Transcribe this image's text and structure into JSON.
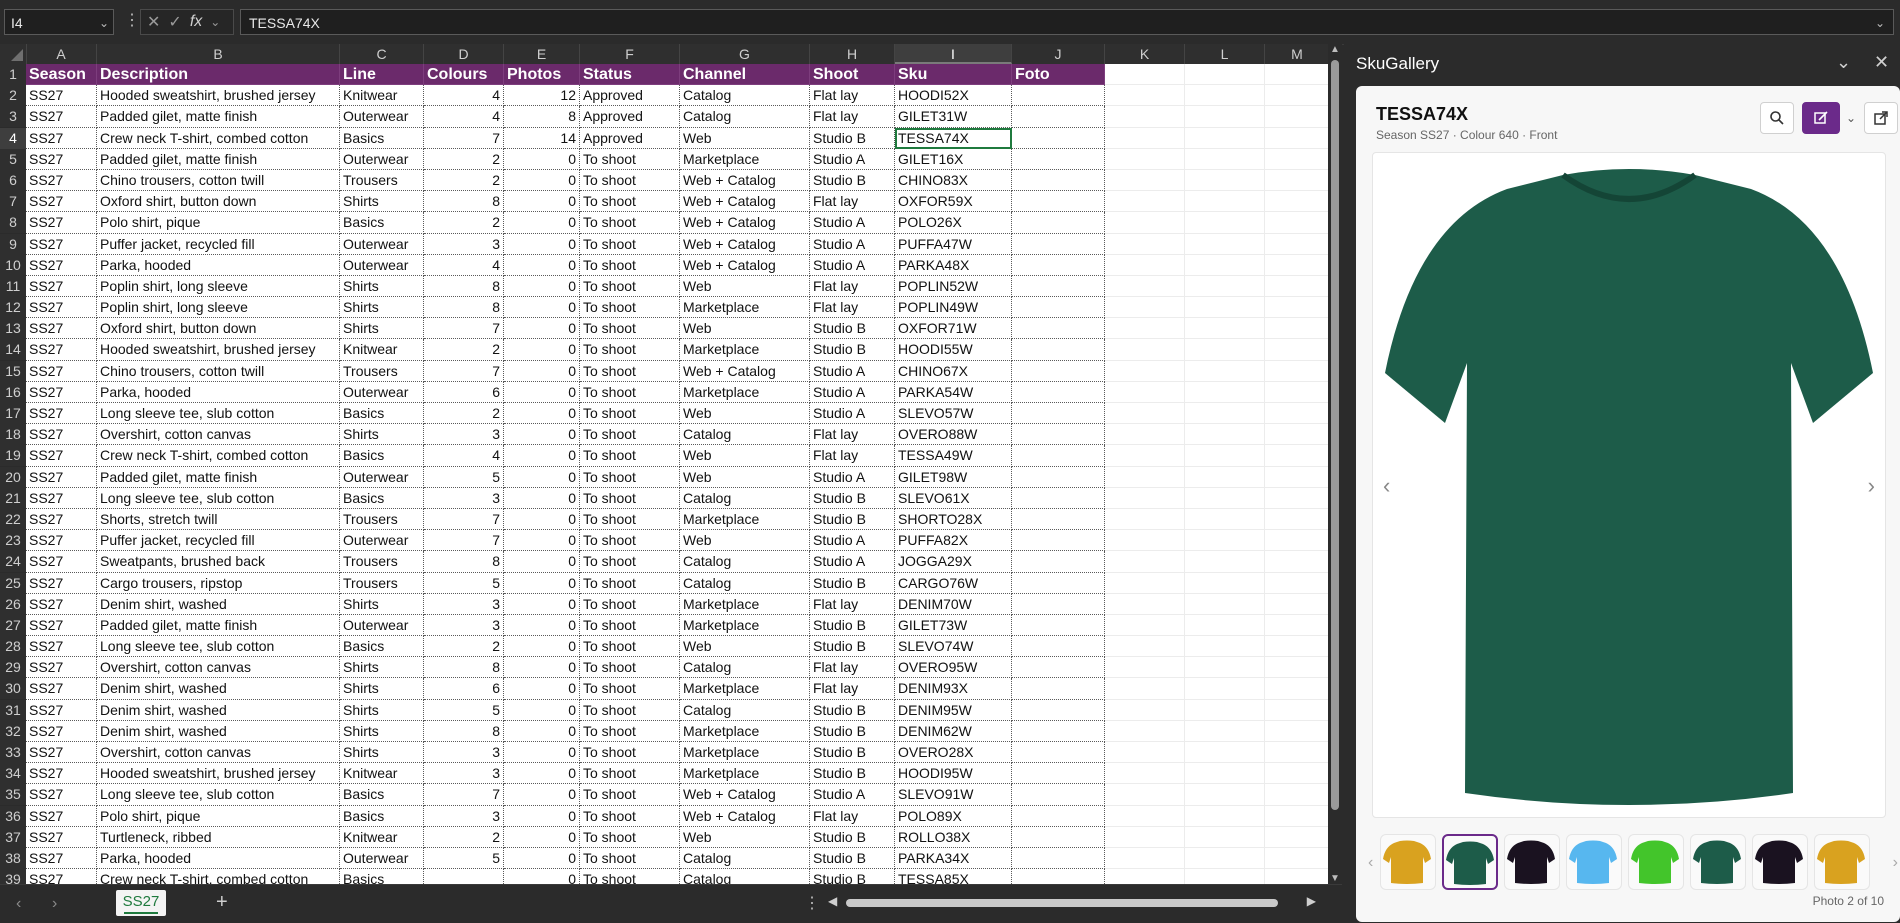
{
  "formula_bar": {
    "name_box": "I4",
    "value": "TESSA74X"
  },
  "columns": [
    "A",
    "B",
    "C",
    "D",
    "E",
    "F",
    "G",
    "H",
    "I",
    "J",
    "K",
    "L",
    "M"
  ],
  "selected_column": "I",
  "selected_row": 4,
  "headers": [
    "Season",
    "Description",
    "Line",
    "Colours",
    "Photos",
    "Status",
    "Channel",
    "Shoot",
    "Sku",
    "Foto"
  ],
  "rows": [
    [
      "SS27",
      "Hooded sweatshirt, brushed jersey",
      "Knitwear",
      "4",
      "12",
      "Approved",
      "Catalog",
      "Flat lay",
      "HOODI52X"
    ],
    [
      "SS27",
      "Padded gilet, matte finish",
      "Outerwear",
      "4",
      "8",
      "Approved",
      "Catalog",
      "Flat lay",
      "GILET31W"
    ],
    [
      "SS27",
      "Crew neck T-shirt, combed cotton",
      "Basics",
      "7",
      "14",
      "Approved",
      "Web",
      "Studio B",
      "TESSA74X"
    ],
    [
      "SS27",
      "Padded gilet, matte finish",
      "Outerwear",
      "2",
      "0",
      "To shoot",
      "Marketplace",
      "Studio A",
      "GILET16X"
    ],
    [
      "SS27",
      "Chino trousers, cotton twill",
      "Trousers",
      "2",
      "0",
      "To shoot",
      "Web + Catalog",
      "Studio B",
      "CHINO83X"
    ],
    [
      "SS27",
      "Oxford shirt, button down",
      "Shirts",
      "8",
      "0",
      "To shoot",
      "Web + Catalog",
      "Flat lay",
      "OXFOR59X"
    ],
    [
      "SS27",
      "Polo shirt, pique",
      "Basics",
      "2",
      "0",
      "To shoot",
      "Web + Catalog",
      "Studio A",
      "POLO26X"
    ],
    [
      "SS27",
      "Puffer jacket, recycled fill",
      "Outerwear",
      "3",
      "0",
      "To shoot",
      "Web + Catalog",
      "Studio A",
      "PUFFA47W"
    ],
    [
      "SS27",
      "Parka, hooded",
      "Outerwear",
      "4",
      "0",
      "To shoot",
      "Web + Catalog",
      "Studio A",
      "PARKA48X"
    ],
    [
      "SS27",
      "Poplin shirt, long sleeve",
      "Shirts",
      "8",
      "0",
      "To shoot",
      "Web",
      "Flat lay",
      "POPLIN52W"
    ],
    [
      "SS27",
      "Poplin shirt, long sleeve",
      "Shirts",
      "8",
      "0",
      "To shoot",
      "Marketplace",
      "Flat lay",
      "POPLIN49W"
    ],
    [
      "SS27",
      "Oxford shirt, button down",
      "Shirts",
      "7",
      "0",
      "To shoot",
      "Web",
      "Studio B",
      "OXFOR71W"
    ],
    [
      "SS27",
      "Hooded sweatshirt, brushed jersey",
      "Knitwear",
      "2",
      "0",
      "To shoot",
      "Marketplace",
      "Studio B",
      "HOODI55W"
    ],
    [
      "SS27",
      "Chino trousers, cotton twill",
      "Trousers",
      "7",
      "0",
      "To shoot",
      "Web + Catalog",
      "Studio A",
      "CHINO67X"
    ],
    [
      "SS27",
      "Parka, hooded",
      "Outerwear",
      "6",
      "0",
      "To shoot",
      "Marketplace",
      "Studio A",
      "PARKA54W"
    ],
    [
      "SS27",
      "Long sleeve tee, slub cotton",
      "Basics",
      "2",
      "0",
      "To shoot",
      "Web",
      "Studio A",
      "SLEVO57W"
    ],
    [
      "SS27",
      "Overshirt, cotton canvas",
      "Shirts",
      "3",
      "0",
      "To shoot",
      "Catalog",
      "Flat lay",
      "OVERO88W"
    ],
    [
      "SS27",
      "Crew neck T-shirt, combed cotton",
      "Basics",
      "4",
      "0",
      "To shoot",
      "Web",
      "Flat lay",
      "TESSA49W"
    ],
    [
      "SS27",
      "Padded gilet, matte finish",
      "Outerwear",
      "5",
      "0",
      "To shoot",
      "Web",
      "Studio A",
      "GILET98W"
    ],
    [
      "SS27",
      "Long sleeve tee, slub cotton",
      "Basics",
      "3",
      "0",
      "To shoot",
      "Catalog",
      "Studio B",
      "SLEVO61X"
    ],
    [
      "SS27",
      "Shorts, stretch twill",
      "Trousers",
      "7",
      "0",
      "To shoot",
      "Marketplace",
      "Studio B",
      "SHORTO28X"
    ],
    [
      "SS27",
      "Puffer jacket, recycled fill",
      "Outerwear",
      "7",
      "0",
      "To shoot",
      "Web",
      "Studio A",
      "PUFFA82X"
    ],
    [
      "SS27",
      "Sweatpants, brushed back",
      "Trousers",
      "8",
      "0",
      "To shoot",
      "Catalog",
      "Studio A",
      "JOGGA29X"
    ],
    [
      "SS27",
      "Cargo trousers, ripstop",
      "Trousers",
      "5",
      "0",
      "To shoot",
      "Catalog",
      "Studio B",
      "CARGO76W"
    ],
    [
      "SS27",
      "Denim shirt, washed",
      "Shirts",
      "3",
      "0",
      "To shoot",
      "Marketplace",
      "Flat lay",
      "DENIM70W"
    ],
    [
      "SS27",
      "Padded gilet, matte finish",
      "Outerwear",
      "3",
      "0",
      "To shoot",
      "Marketplace",
      "Studio B",
      "GILET73W"
    ],
    [
      "SS27",
      "Long sleeve tee, slub cotton",
      "Basics",
      "2",
      "0",
      "To shoot",
      "Web",
      "Studio B",
      "SLEVO74W"
    ],
    [
      "SS27",
      "Overshirt, cotton canvas",
      "Shirts",
      "8",
      "0",
      "To shoot",
      "Catalog",
      "Flat lay",
      "OVERO95W"
    ],
    [
      "SS27",
      "Denim shirt, washed",
      "Shirts",
      "6",
      "0",
      "To shoot",
      "Marketplace",
      "Flat lay",
      "DENIM93X"
    ],
    [
      "SS27",
      "Denim shirt, washed",
      "Shirts",
      "5",
      "0",
      "To shoot",
      "Catalog",
      "Studio B",
      "DENIM95W"
    ],
    [
      "SS27",
      "Denim shirt, washed",
      "Shirts",
      "8",
      "0",
      "To shoot",
      "Marketplace",
      "Studio B",
      "DENIM62W"
    ],
    [
      "SS27",
      "Overshirt, cotton canvas",
      "Shirts",
      "3",
      "0",
      "To shoot",
      "Marketplace",
      "Studio B",
      "OVERO28X"
    ],
    [
      "SS27",
      "Hooded sweatshirt, brushed jersey",
      "Knitwear",
      "3",
      "0",
      "To shoot",
      "Marketplace",
      "Studio B",
      "HOODI95W"
    ],
    [
      "SS27",
      "Long sleeve tee, slub cotton",
      "Basics",
      "7",
      "0",
      "To shoot",
      "Web + Catalog",
      "Studio A",
      "SLEVO91W"
    ],
    [
      "SS27",
      "Polo shirt, pique",
      "Basics",
      "3",
      "0",
      "To shoot",
      "Web + Catalog",
      "Flat lay",
      "POLO89X"
    ],
    [
      "SS27",
      "Turtleneck, ribbed",
      "Knitwear",
      "2",
      "0",
      "To shoot",
      "Web",
      "Studio B",
      "ROLLO38X"
    ],
    [
      "SS27",
      "Parka, hooded",
      "Outerwear",
      "5",
      "0",
      "To shoot",
      "Catalog",
      "Studio B",
      "PARKA34X"
    ],
    [
      "SS27",
      "Crew neck T-shirt, combed cotton",
      "Basics",
      "",
      "0",
      "To shoot",
      "Catalog",
      "Studio B",
      "TESSA85X"
    ]
  ],
  "sheet_tab": "SS27",
  "panel": {
    "title": "SkuGallery",
    "sku": "TESSA74X",
    "subtitle": "Season SS27 · Colour 640 · Front",
    "photo_count": "Photo 2 of 10",
    "thumb_colors": [
      "#d9a21f",
      "#1d5c49",
      "#1a1220",
      "#57b7ef",
      "#43c52b",
      "#1d5c49",
      "#1a1220",
      "#d9a21f"
    ],
    "active_thumb": 2,
    "main_color": "#1d5c49"
  },
  "colors": {
    "header_bg": "#6b2a6b",
    "accent": "#6b2a8a",
    "selection": "#1f7a3e"
  },
  "icons": [
    "search-icon",
    "edit-icon",
    "open-external-icon",
    "chevron-down-icon",
    "close-icon",
    "chevron-left-icon",
    "chevron-right-icon",
    "add-icon",
    "more-icon",
    "function-icon",
    "cancel-icon",
    "confirm-icon"
  ]
}
